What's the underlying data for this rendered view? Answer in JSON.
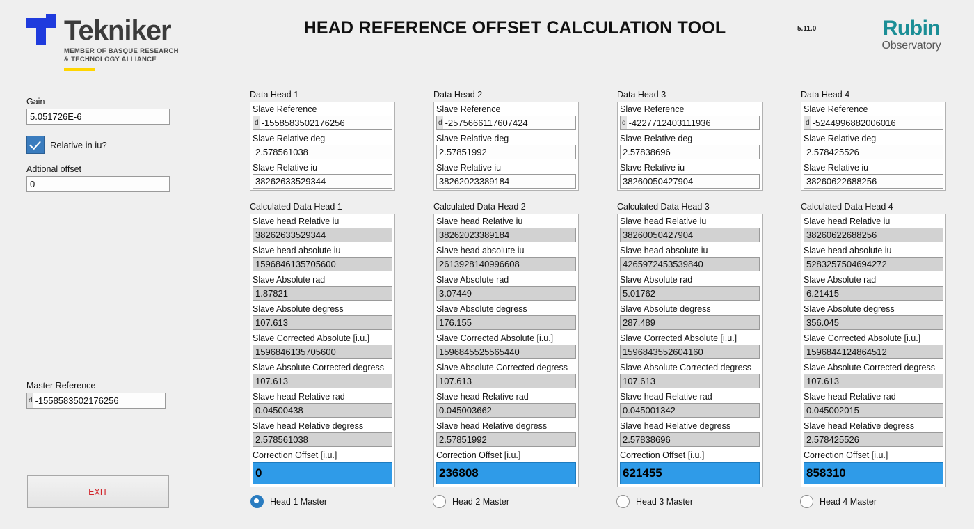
{
  "header": {
    "title": "HEAD REFERENCE OFFSET CALCULATION TOOL",
    "version": "5.11.0",
    "tekniker": {
      "word": "Tekniker",
      "tagline_line1": "MEMBER OF BASQUE RESEARCH",
      "tagline_line2": "& TECHNOLOGY ALLIANCE"
    },
    "rubin": {
      "word": "Rubin",
      "sub": "Observatory"
    }
  },
  "left_panel": {
    "gain_label": "Gain",
    "gain_value": "5.051726E-6",
    "relative_checkbox_label": "Relative in iu?",
    "relative_checkbox_checked": true,
    "additional_offset_label": "Adtional offset",
    "additional_offset_value": "0",
    "master_reference_label": "Master Reference",
    "master_reference_radix": "d",
    "master_reference_value": "-1558583502176256",
    "exit_label": "EXIT"
  },
  "labels": {
    "slave_reference": "Slave Reference",
    "slave_relative_deg": "Slave Relative deg",
    "slave_relative_iu": "Slave Relative iu",
    "slave_head_relative_iu": "Slave head Relative iu",
    "slave_head_absolute_iu": "Slave head absolute iu",
    "slave_absolute_rad": "Slave Absolute rad",
    "slave_absolute_degress": "Slave Absolute degress",
    "slave_corrected_absolute": "Slave Corrected Absolute [i.u.]",
    "slave_absolute_corrected_degress": "Slave Absolute Corrected degress",
    "slave_head_relative_rad": "Slave head Relative rad",
    "slave_head_relative_degress": "Slave head Relative degress",
    "correction_offset": "Correction Offset [i.u.]"
  },
  "colors": {
    "background": "#efefef",
    "highlight": "#2f9be8",
    "readonly_field": "#d2d2d2",
    "accent_blue": "#1f3bdd",
    "rubin_teal": "#1b8e96",
    "exit_red": "#d1242a"
  },
  "heads": [
    {
      "data_title": "Data Head 1",
      "calc_title": "Calculated Data Head 1",
      "radix": "d",
      "slave_reference": "-1558583502176256",
      "slave_relative_deg": "2.578561038",
      "slave_relative_iu": "38262633529344",
      "slave_head_relative_iu": "38262633529344",
      "slave_head_absolute_iu": "1596846135705600",
      "slave_absolute_rad": "1.87821",
      "slave_absolute_degress": "107.613",
      "slave_corrected_absolute": "1596846135705600",
      "slave_absolute_corrected_degress": "107.613",
      "slave_head_relative_rad": "0.04500438",
      "slave_head_relative_degress": "2.578561038",
      "correction_offset": "0",
      "radio_label": "Head 1 Master",
      "radio_selected": true
    },
    {
      "data_title": "Data Head 2",
      "calc_title": "Calculated Data Head 2",
      "radix": "d",
      "slave_reference": "-2575666117607424",
      "slave_relative_deg": "2.57851992",
      "slave_relative_iu": "38262023389184",
      "slave_head_relative_iu": "38262023389184",
      "slave_head_absolute_iu": "2613928140996608",
      "slave_absolute_rad": "3.07449",
      "slave_absolute_degress": "176.155",
      "slave_corrected_absolute": "1596845525565440",
      "slave_absolute_corrected_degress": "107.613",
      "slave_head_relative_rad": "0.045003662",
      "slave_head_relative_degress": "2.57851992",
      "correction_offset": "236808",
      "radio_label": "Head 2 Master",
      "radio_selected": false
    },
    {
      "data_title": "Data Head 3",
      "calc_title": "Calculated Data Head 3",
      "radix": "d",
      "slave_reference": "-4227712403111936",
      "slave_relative_deg": "2.57838696",
      "slave_relative_iu": "38260050427904",
      "slave_head_relative_iu": "38260050427904",
      "slave_head_absolute_iu": "4265972453539840",
      "slave_absolute_rad": "5.01762",
      "slave_absolute_degress": "287.489",
      "slave_corrected_absolute": "1596843552604160",
      "slave_absolute_corrected_degress": "107.613",
      "slave_head_relative_rad": "0.045001342",
      "slave_head_relative_degress": "2.57838696",
      "correction_offset": "621455",
      "radio_label": "Head 3 Master",
      "radio_selected": false
    },
    {
      "data_title": "Data Head 4",
      "calc_title": "Calculated Data Head 4",
      "radix": "d",
      "slave_reference": "-5244996882006016",
      "slave_relative_deg": "2.578425526",
      "slave_relative_iu": "38260622688256",
      "slave_head_relative_iu": "38260622688256",
      "slave_head_absolute_iu": "5283257504694272",
      "slave_absolute_rad": "6.21415",
      "slave_absolute_degress": "356.045",
      "slave_corrected_absolute": "1596844124864512",
      "slave_absolute_corrected_degress": "107.613",
      "slave_head_relative_rad": "0.045002015",
      "slave_head_relative_degress": "2.578425526",
      "correction_offset": "858310",
      "radio_label": "Head 4 Master",
      "radio_selected": false
    }
  ]
}
